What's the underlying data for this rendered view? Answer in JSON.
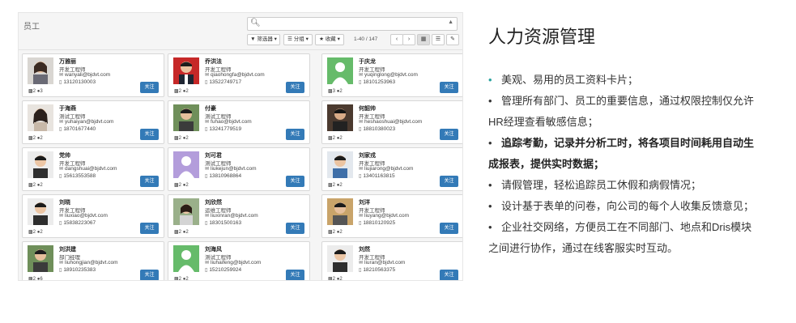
{
  "app": {
    "title": "员工",
    "search_placeholder": "",
    "filters_label": "筛选器",
    "group_label": "分组",
    "fav_label": "收藏",
    "pager": "1-40 / 147",
    "search_icon": "search-icon",
    "caret_icon": "caret-up-icon"
  },
  "employees": [
    {
      "name": "万雅丽",
      "role": "开发工程师",
      "email": "wanyali@bjdvt.com",
      "phone": "13120130003",
      "followers": "2",
      "following": "3",
      "follow_label": "关注",
      "photo_style": "female"
    },
    {
      "name": "乔洪法",
      "role": "开发工程师",
      "email": "qiaohongfa@bjdvt.com",
      "phone": "13522749717",
      "followers": "2",
      "following": "2",
      "follow_label": "关注",
      "photo_style": "male-red"
    },
    {
      "name": "于庆龙",
      "role": "开发工程师",
      "email": "yuqinglong@bjdvt.com",
      "phone": "18101253963",
      "followers": "3",
      "following": "2",
      "follow_label": "关注",
      "photo_style": "green-placeholder"
    },
    {
      "name": "于海燕",
      "role": "测试工程师",
      "email": "yuhaiyan@bjdvt.com",
      "phone": "18701677440",
      "followers": "2",
      "following": "2",
      "follow_label": "关注",
      "photo_style": "female-light"
    },
    {
      "name": "付豪",
      "role": "测试工程师",
      "email": "fuhao@bjdvt.com",
      "phone": "13241779519",
      "followers": "2",
      "following": "2",
      "follow_label": "关注",
      "photo_style": "male-outdoor"
    },
    {
      "name": "何韶帅",
      "role": "开发工程师",
      "email": "heshaoshuai@bjdvt.com",
      "phone": "18810380023",
      "followers": "2",
      "following": "2",
      "follow_label": "关注",
      "photo_style": "male-dark"
    },
    {
      "name": "党帅",
      "role": "开发工程师",
      "email": "dangshuai@bjdvt.com",
      "phone": "15613553588",
      "followers": "2",
      "following": "2",
      "follow_label": "关注",
      "photo_style": "male-plain"
    },
    {
      "name": "刘可君",
      "role": "测试工程师",
      "email": "liukejun@bjdvt.com",
      "phone": "13810968864",
      "followers": "2",
      "following": "2",
      "follow_label": "关注",
      "photo_style": "purple-placeholder"
    },
    {
      "name": "刘家戎",
      "role": "开发工程师",
      "email": "liujiarong@bjdvt.com",
      "phone": "13401163815",
      "followers": "2",
      "following": "2",
      "follow_label": "关注",
      "photo_style": "male-blue"
    },
    {
      "name": "刘晓",
      "role": "开发工程师",
      "email": "liuxiao@bjdvt.com",
      "phone": "15838223067",
      "followers": "2",
      "following": "2",
      "follow_label": "关注",
      "photo_style": "male-plain"
    },
    {
      "name": "刘欣然",
      "role": "运维工程师",
      "email": "liuxinran@bjdvt.com",
      "phone": "18301500163",
      "followers": "2",
      "following": "2",
      "follow_label": "关注",
      "photo_style": "female-outdoor"
    },
    {
      "name": "刘洋",
      "role": "开发工程师",
      "email": "liuyang@bjdvt.com",
      "phone": "18810120925",
      "followers": "2",
      "following": "2",
      "follow_label": "关注",
      "photo_style": "male-casual"
    },
    {
      "name": "刘洪建",
      "role": "部门经理",
      "email": "liuhongjian@bjdvt.com",
      "phone": "18910235383",
      "followers": "2",
      "following": "6",
      "follow_label": "关注",
      "photo_style": "male-outdoor"
    },
    {
      "name": "刘海风",
      "role": "测试工程师",
      "email": "liuhaifeng@bjdvt.com",
      "phone": "15210259924",
      "followers": "2",
      "following": "2",
      "follow_label": "关注",
      "photo_style": "green-placeholder"
    },
    {
      "name": "刘然",
      "role": "开发工程师",
      "email": "liuran@bjdvt.com",
      "phone": "18210563375",
      "followers": "2",
      "following": "2",
      "follow_label": "关注",
      "photo_style": "male-plain"
    }
  ],
  "right": {
    "title": "人力资源管理",
    "items": [
      {
        "lines": [
          "美观、易用的员工资料卡片；"
        ],
        "bold": false,
        "teal": true
      },
      {
        "lines": [
          "管理所有部门、员工的重要信息，通过权限控制仅允许",
          "HR经理查看敏感信息；"
        ],
        "bold": false,
        "teal": false
      },
      {
        "lines": [
          "追踪考勤，记录并分析工时，将各项目时间耗用自动生",
          "成报表，提供实时数据；"
        ],
        "bold": true,
        "teal": false
      },
      {
        "lines": [
          "请假管理，轻松追踪员工休假和病假情况；"
        ],
        "bold": false,
        "teal": false
      },
      {
        "lines": [
          "设计基于表单的问卷，向公司的每个人收集反馈意见；"
        ],
        "bold": false,
        "teal": false
      },
      {
        "lines": [
          "企业社交网络，方便员工在不同部门、地点和Dris模块",
          "之间进行协作，通过在线客服实时互动。"
        ],
        "bold": false,
        "teal": false
      }
    ]
  }
}
